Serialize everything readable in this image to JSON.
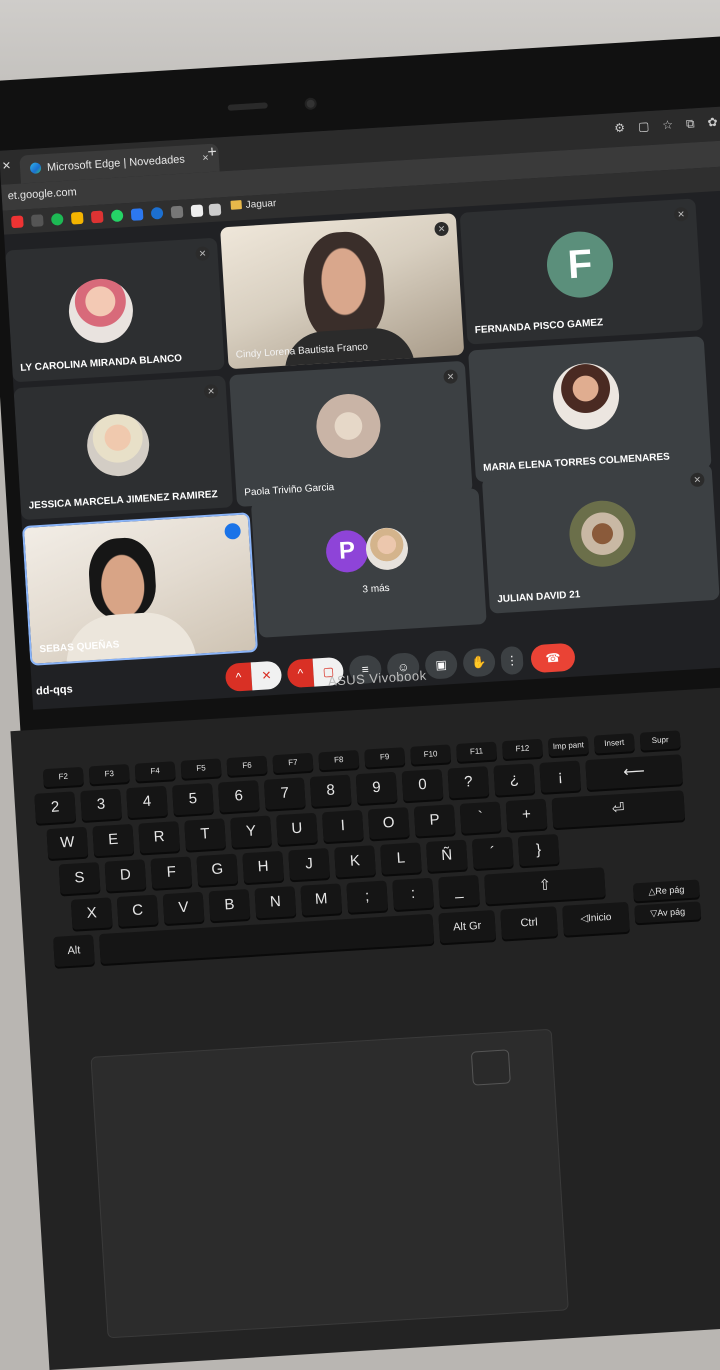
{
  "browser": {
    "tab_title": "Microsoft Edge | Novedades",
    "tab_close": "×",
    "new_tab": "+",
    "url": "et.google.com",
    "bookmark_folder": "Jaguar"
  },
  "meet": {
    "participants": [
      {
        "name": "LY CAROLINA MIRANDA BLANCO"
      },
      {
        "name": "Cindy Lorena Bautista Franco"
      },
      {
        "name": "FERNANDA PISCO GAMEZ",
        "initial": "F"
      },
      {
        "name": "JESSICA MARCELA JIMENEZ RAMIREZ"
      },
      {
        "name": "Paola Triviño Garcia"
      },
      {
        "name": "MARIA ELENA TORRES COLMENARES"
      },
      {
        "name": "SEBAS   QUEÑAS"
      },
      {
        "name": "3 más",
        "initial": "P"
      },
      {
        "name": "JULIAN DAVID 21"
      }
    ],
    "meeting_code": "dd-qqs"
  },
  "laptop": {
    "brand": "ASUS Vivobook"
  },
  "keyboard": {
    "row_num": [
      "2",
      "3",
      "4",
      "5",
      "6",
      "7",
      "8",
      "9",
      "0",
      "?",
      "¿",
      "¡"
    ],
    "row_q": [
      "W",
      "E",
      "R",
      "T",
      "Y",
      "U",
      "I",
      "O",
      "P",
      "`",
      "+"
    ],
    "row_a": [
      "S",
      "D",
      "F",
      "G",
      "H",
      "J",
      "K",
      "L",
      "Ñ",
      "´",
      "}"
    ],
    "row_z": [
      "X",
      "C",
      "V",
      "B",
      "N",
      "M",
      ";",
      ":",
      "_"
    ],
    "alt": "Alt",
    "altgr": "Alt Gr",
    "ctrl": "Ctrl",
    "inicio": "◁Inicio",
    "repag": "△Re pág",
    "avpag": "▽Av pág",
    "insert": "Insert",
    "supr": "Supr",
    "imp": "Imp pant"
  },
  "colors": {
    "meet_bg": "#202124",
    "tile_bg": "#3c4043",
    "end_call": "#ea4335",
    "muted": "#d93025",
    "avatar_f": "#5b8f7b",
    "avatar_p": "#8e44d8"
  }
}
